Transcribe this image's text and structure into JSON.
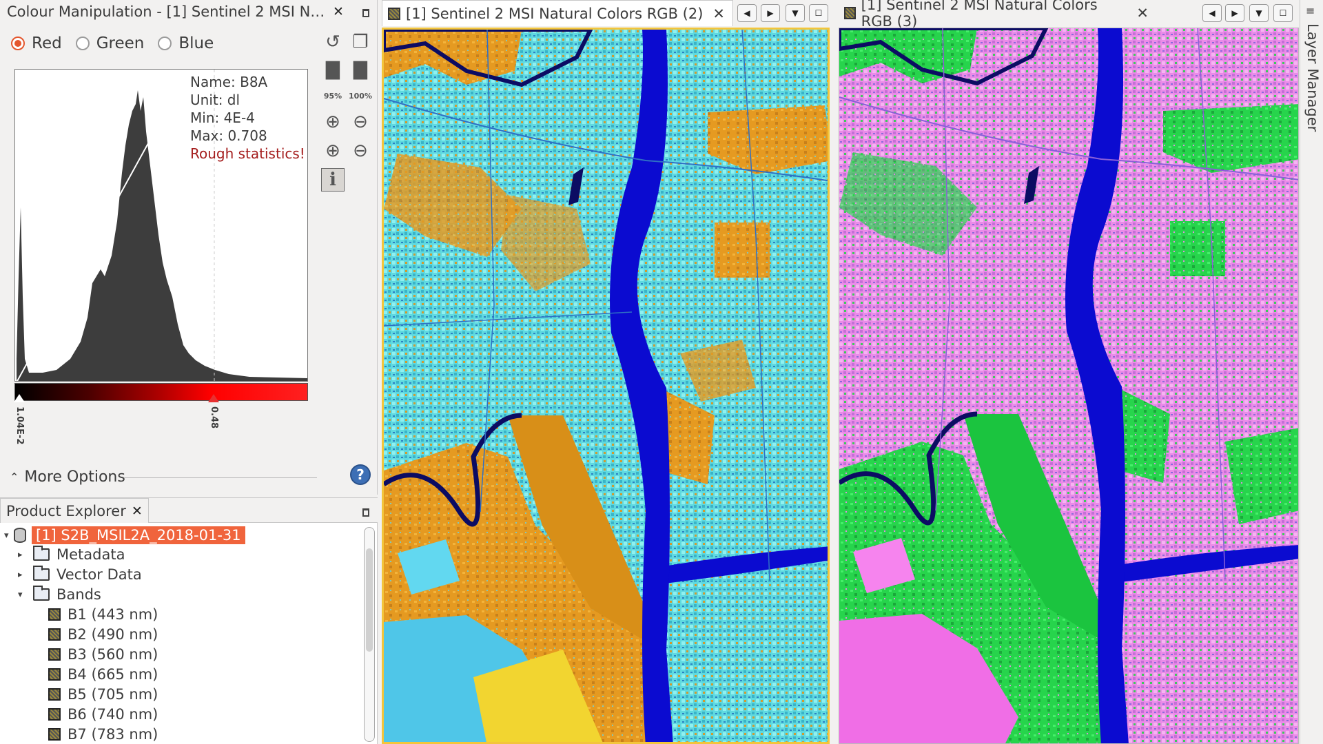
{
  "colour_manipulation": {
    "tab_title": "Colour Manipulation - [1] Sentinel 2 MSI Natu...",
    "channels": [
      "Red",
      "Green",
      "Blue"
    ],
    "selected_channel": "Red",
    "info": {
      "name": "Name: B8A",
      "unit": "Unit: dl",
      "min": "Min: 4E-4",
      "max": "Max: 0.708",
      "warning": "Rough statistics!"
    },
    "slider_min_label": "1.04E-2",
    "slider_max_label": "0.48",
    "slider_min_value": 0.0104,
    "slider_max_value": 0.48,
    "tool_zoom_95": "95%",
    "tool_zoom_100": "100%",
    "more_options": "More Options",
    "help": "?"
  },
  "product_explorer": {
    "tab_title": "Product Explorer",
    "product": "[1] S2B_MSIL2A_2018-01-31",
    "nodes": [
      "Metadata",
      "Vector Data",
      "Bands"
    ],
    "bands": [
      "B1 (443 nm)",
      "B2 (490 nm)",
      "B3 (560 nm)",
      "B4 (665 nm)",
      "B5 (705 nm)",
      "B6 (740 nm)",
      "B7 (783 nm)"
    ]
  },
  "views": [
    {
      "title": "[1] Sentinel 2 MSI Natural Colors RGB (2)",
      "active": true
    },
    {
      "title": "[1] Sentinel 2 MSI Natural Colors RGB (3)",
      "active": false
    }
  ],
  "layer_manager": "Layer Manager",
  "colors": {
    "accent": "#e4572e",
    "selection": "#f0643c",
    "active_view_border": "#f3c53b",
    "warning": "#a41c1c"
  }
}
